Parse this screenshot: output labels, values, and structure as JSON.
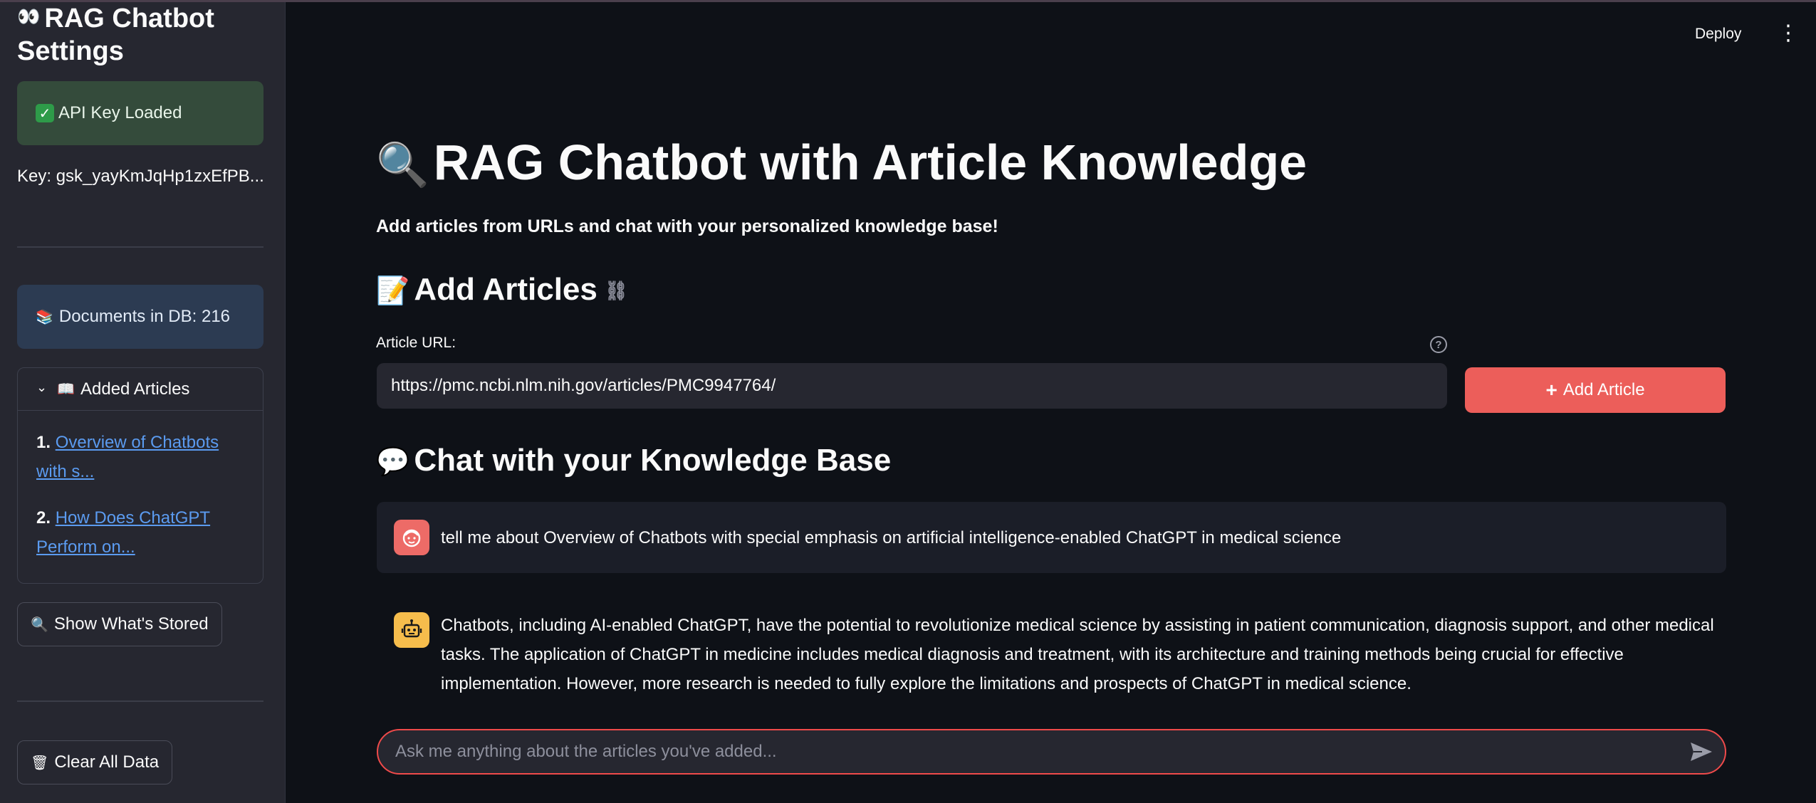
{
  "sidebar": {
    "title": "RAG Chatbot Settings",
    "title_icon": "eyes-icon",
    "api_status": "API Key Loaded",
    "key_text": "Key: gsk_yayKmJqHp1zxEfPB...",
    "docs_count": "Documents in DB: 216",
    "expander": {
      "label": "Added Articles",
      "items": [
        {
          "num": "1.",
          "title": "Overview of Chatbots with s..."
        },
        {
          "num": "2.",
          "title": "How Does ChatGPT Perform on..."
        }
      ]
    },
    "show_stored_label": "Show What's Stored",
    "clear_label": "Clear All Data"
  },
  "header": {
    "deploy_label": "Deploy",
    "menu_icon": "kebab-menu-icon"
  },
  "main": {
    "title": "RAG Chatbot with Article Knowledge",
    "subtitle": "Add articles from URLs and chat with your personalized knowledge base!",
    "add_section": {
      "heading": "Add Articles",
      "url_label": "Article URL:",
      "url_value": "https://pmc.ncbi.nlm.nih.gov/articles/PMC9947764/",
      "button_label": "Add Article"
    },
    "chat_section": {
      "heading": "Chat with your Knowledge Base",
      "messages": [
        {
          "role": "user",
          "text": "tell me about Overview of Chatbots with special emphasis on artificial intelligence-enabled ChatGPT in medical science"
        },
        {
          "role": "assistant",
          "text": "Chatbots, including AI-enabled ChatGPT, have the potential to revolutionize medical science by assisting in patient communication, diagnosis support, and other medical tasks. The application of ChatGPT in medicine includes medical diagnosis and treatment, with its architecture and training methods being crucial for effective implementation. However, more research is needed to fully explore the limitations and prospects of ChatGPT in medical science."
        }
      ],
      "input_placeholder": "Ask me anything about the articles you've added..."
    }
  },
  "colors": {
    "background": "#0e1117",
    "sidebar": "#262730",
    "accent": "#ec5e5a",
    "success_box": "#344b3b",
    "info_box": "#2c3b52",
    "link": "#5b9bf0"
  }
}
